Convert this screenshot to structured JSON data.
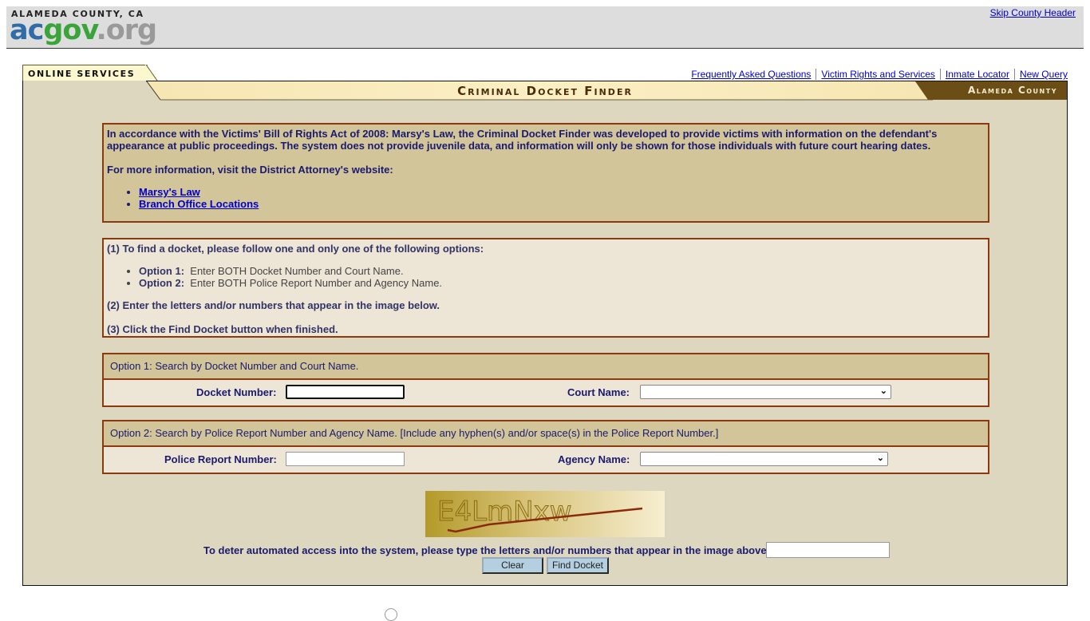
{
  "county_header": {
    "county_name": "ALAMEDA COUNTY, CA",
    "logo": {
      "ac": "ac",
      "gov": "gov",
      "org": ".org"
    },
    "skip_link": "Skip County Header"
  },
  "online_services_tab": "ONLINE SERVICES",
  "top_nav": [
    {
      "label": "Frequently Asked Questions"
    },
    {
      "label": "Victim Rights and Services"
    },
    {
      "label": "Inmate Locator"
    },
    {
      "label": "New Query"
    }
  ],
  "title_bar": {
    "title": "Criminal Docket Finder",
    "county_badge": "Alameda County"
  },
  "info_box": {
    "paragraph": "In accordance with the Victims' Bill of Rights Act of 2008:  Marsy's Law, the Criminal Docket Finder was developed to provide victims with information on the defendant's appearance at public proceedings.  The system does not provide juvenile data, and information will only be shown for those individuals with future court hearing dates.",
    "more_info": "For more information, visit the District Attorney's website:",
    "links": [
      {
        "label": "Marsy's Law"
      },
      {
        "label": "Branch Office Locations"
      }
    ]
  },
  "instructions": {
    "step1": "(1) To find a docket, please follow one and only one of the following options:",
    "options": [
      {
        "label": "Option 1:",
        "text": "Enter BOTH Docket Number and Court Name."
      },
      {
        "label": "Option 2:",
        "text": "Enter BOTH Police Report Number and Agency Name."
      }
    ],
    "step2": "(2) Enter the letters and/or numbers that appear in the image below.",
    "step3": "(3) Click the Find Docket button when finished."
  },
  "option1": {
    "header": "Option 1:  Search by Docket Number and Court Name.",
    "docket_label": "Docket Number:",
    "docket_value": "",
    "court_label": "Court Name:",
    "court_selected": ""
  },
  "option2": {
    "header": "Option 2:  Search by Police Report Number and Agency Name.  [Include any hyphen(s) and/or space(s) in the Police Report Number.]",
    "police_label": "Police Report Number:",
    "police_value": "",
    "agency_label": "Agency Name:",
    "agency_selected": ""
  },
  "captcha": {
    "image_text": "E4LmNxw",
    "prompt": "To deter automated access into the system, please type the letters and/or numbers that appear in the image above.",
    "input_value": ""
  },
  "buttons": {
    "clear": "Clear",
    "find": "Find Docket"
  },
  "colors": {
    "link": "#0000cc",
    "body_text": "#1a1a6e",
    "border_accent": "#8b3a10",
    "panel_bg": "#ddd7c0",
    "info_bg": "#d3c59a",
    "badge_bg": "#6b4e16"
  }
}
